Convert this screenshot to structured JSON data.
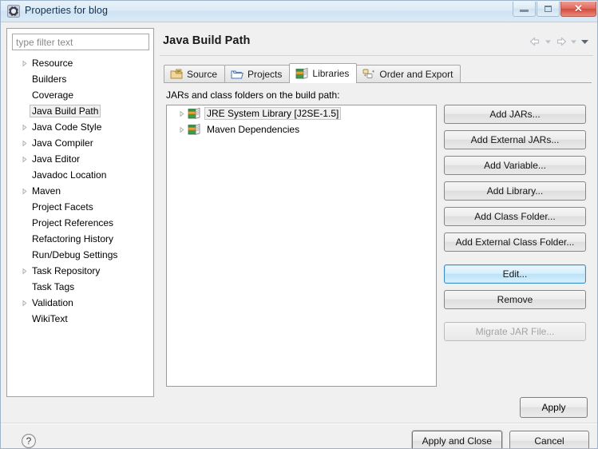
{
  "window": {
    "title": "Properties for blog",
    "icon": "eclipse-gear-icon",
    "controls": {
      "minimize": "Minimize",
      "maximize": "Maximize",
      "close": "Close",
      "close_glyph": "✕"
    }
  },
  "sidebar": {
    "filter": {
      "value": "",
      "placeholder": "type filter text"
    },
    "items": [
      {
        "label": "Resource",
        "expandable": true,
        "selected": false
      },
      {
        "label": "Builders",
        "expandable": false,
        "selected": false
      },
      {
        "label": "Coverage",
        "expandable": false,
        "selected": false
      },
      {
        "label": "Java Build Path",
        "expandable": false,
        "selected": true
      },
      {
        "label": "Java Code Style",
        "expandable": true,
        "selected": false
      },
      {
        "label": "Java Compiler",
        "expandable": true,
        "selected": false
      },
      {
        "label": "Java Editor",
        "expandable": true,
        "selected": false
      },
      {
        "label": "Javadoc Location",
        "expandable": false,
        "selected": false
      },
      {
        "label": "Maven",
        "expandable": true,
        "selected": false
      },
      {
        "label": "Project Facets",
        "expandable": false,
        "selected": false
      },
      {
        "label": "Project References",
        "expandable": false,
        "selected": false
      },
      {
        "label": "Refactoring History",
        "expandable": false,
        "selected": false
      },
      {
        "label": "Run/Debug Settings",
        "expandable": false,
        "selected": false
      },
      {
        "label": "Task Repository",
        "expandable": true,
        "selected": false
      },
      {
        "label": "Task Tags",
        "expandable": false,
        "selected": false
      },
      {
        "label": "Validation",
        "expandable": true,
        "selected": false
      },
      {
        "label": "WikiText",
        "expandable": false,
        "selected": false
      }
    ]
  },
  "page": {
    "title": "Java Build Path",
    "nav": {
      "back": "back-arrow-icon",
      "back_menu": "back-dropdown-icon",
      "forward": "forward-arrow-icon",
      "forward_menu": "forward-dropdown-icon",
      "view_menu": "view-menu-icon"
    },
    "tabs": [
      {
        "label": "Source",
        "icon": "source-folder-icon",
        "active": false
      },
      {
        "label": "Projects",
        "icon": "project-folder-icon",
        "active": false
      },
      {
        "label": "Libraries",
        "icon": "library-books-icon",
        "active": true
      },
      {
        "label": "Order and Export",
        "icon": "order-export-icon",
        "active": false
      }
    ],
    "libraries": {
      "hint": "JARs and class folders on the build path:",
      "nodes": [
        {
          "label": "JRE System Library [J2SE-1.5]",
          "icon": "library-books-icon",
          "selected": true
        },
        {
          "label": "Maven Dependencies",
          "icon": "library-books-icon",
          "selected": false
        }
      ]
    },
    "buttons": [
      {
        "label": "Add JARs...",
        "state": "normal"
      },
      {
        "label": "Add External JARs...",
        "state": "normal"
      },
      {
        "label": "Add Variable...",
        "state": "normal"
      },
      {
        "label": "Add Library...",
        "state": "normal"
      },
      {
        "label": "Add Class Folder...",
        "state": "normal"
      },
      {
        "label": "Add External Class Folder...",
        "state": "normal"
      },
      {
        "label": "Edit...",
        "state": "focused"
      },
      {
        "label": "Remove",
        "state": "normal"
      },
      {
        "label": "Migrate JAR File...",
        "state": "disabled"
      }
    ],
    "apply_label": "Apply"
  },
  "footer": {
    "help": "help-icon",
    "help_glyph": "?",
    "apply_and_close": "Apply and Close",
    "cancel": "Cancel"
  },
  "colors": {
    "titlebar_accent": "#cfe3f3",
    "close_red": "#d24b3c",
    "focus_blue": "#3c8fc2",
    "selection_grey": "#f0f0f0"
  }
}
